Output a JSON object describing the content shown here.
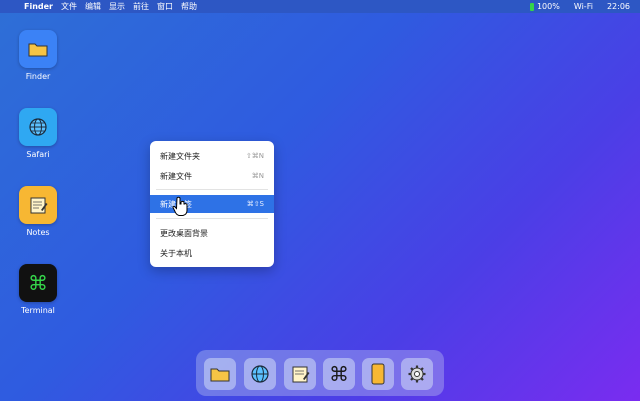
{
  "menubar": {
    "app_name": "Finder",
    "menus": [
      "文件",
      "编辑",
      "显示",
      "前往",
      "窗口",
      "帮助"
    ],
    "battery": "100%",
    "wifi": "Wi-Fi",
    "clock": "22:06"
  },
  "desktop": {
    "icons": [
      {
        "label": "Finder",
        "icon": "folder-icon"
      },
      {
        "label": "Safari",
        "icon": "globe-icon"
      },
      {
        "label": "Notes",
        "icon": "notes-icon"
      },
      {
        "label": "Terminal",
        "icon": "command-icon"
      }
    ]
  },
  "context_menu": {
    "items": [
      {
        "label": "新建文件夹",
        "shortcut": "⇧⌘N"
      },
      {
        "label": "新建文件",
        "shortcut": "⌘N"
      },
      {
        "label": "新建标签",
        "shortcut": "⌘⇧S",
        "selected": true
      },
      {
        "label": "更改桌面背景",
        "shortcut": ""
      },
      {
        "label": "关于本机",
        "shortcut": ""
      }
    ]
  },
  "dock": {
    "items": [
      "folder-icon",
      "globe-icon",
      "notes-icon",
      "command-icon",
      "phone-icon",
      "settings-icon"
    ]
  },
  "colors": {
    "accent": "#2e72e6",
    "terminal_green": "#35d44a"
  }
}
